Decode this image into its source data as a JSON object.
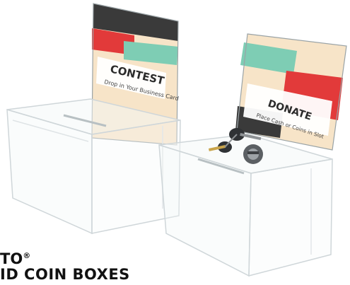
{
  "image": {
    "description_labels": true
  },
  "sign_left": {
    "title": "CONTEST",
    "subtitle": "Drop in Your Business Card"
  },
  "sign_right": {
    "title": "DONATE",
    "subtitle": "Place Cash or Coins in Slot"
  },
  "caption": {
    "brand": "TO",
    "trademark": "®",
    "product": "ID COIN BOXES"
  },
  "palette": {
    "dark": "#3a3a3a",
    "red": "#e23a3a",
    "teal": "#7ecdb4",
    "cream": "#f9e3c4",
    "acrylic_edge": "#cfd6d9"
  }
}
